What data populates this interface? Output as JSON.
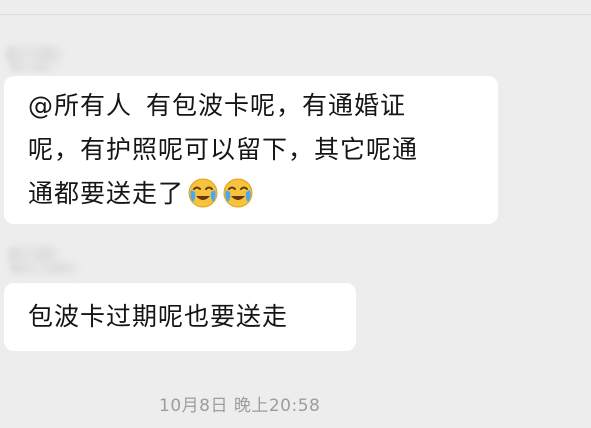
{
  "chat": {
    "messages": [
      {
        "lines": [
          {
            "mention": "@所有人",
            "text": "有包波卡呢，有通婚证"
          },
          {
            "text": "呢，有护照呢可以留下，其它呢通"
          },
          {
            "text": "通都要送走了"
          }
        ],
        "emojis": [
          "face-with-tears-emoji",
          "face-with-tears-emoji"
        ]
      },
      {
        "lines": [
          {
            "text": "包波卡过期呢也要送走"
          }
        ]
      }
    ],
    "timestamp": "10月8日 晚上20:58"
  },
  "colors": {
    "background": "#ededed",
    "bubble": "#ffffff",
    "text": "#151515",
    "timestamp": "#9d9d9d"
  }
}
